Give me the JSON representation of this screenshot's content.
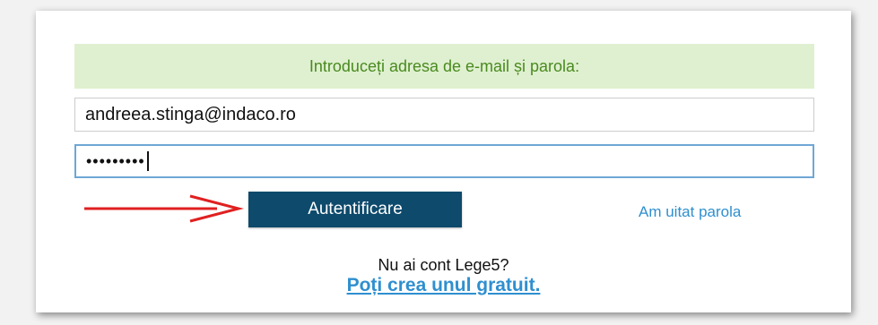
{
  "login": {
    "instruction": "Introduceți adresa de e-mail și parola:",
    "email_value": "andreea.stinga@indaco.ro",
    "password_mask": "•••••••••",
    "submit_label": "Autentificare",
    "forgot_label": "Am uitat parola",
    "no_account_text": "Nu ai cont Lege5?",
    "create_account_label": "Poți crea unul gratuit."
  },
  "colors": {
    "banner_bg": "#dff0d0",
    "banner_text": "#4a8a1f",
    "button_bg": "#0e4a6c",
    "link": "#2f8fcf",
    "focus_border": "#6ea7d6",
    "arrow": "#e02020"
  },
  "icons": {
    "arrow": "right-arrow-icon"
  }
}
